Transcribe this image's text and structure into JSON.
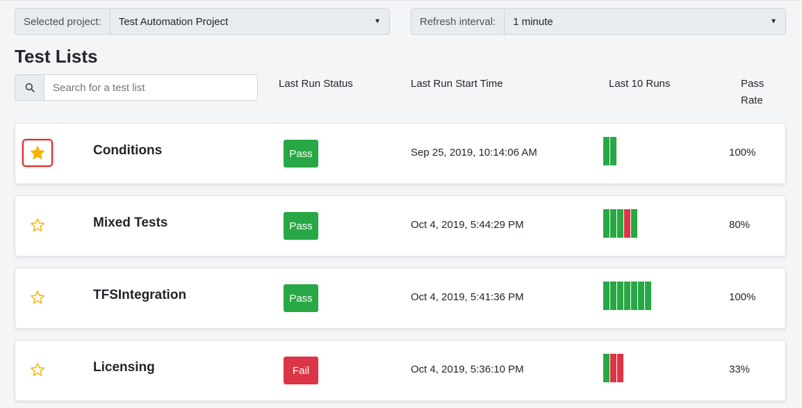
{
  "header": {
    "project_label": "Selected project:",
    "project_value": "Test Automation Project",
    "refresh_label": "Refresh interval:",
    "refresh_value": "1 minute"
  },
  "page_title": "Test Lists",
  "search": {
    "placeholder": "Search for a test list",
    "value": ""
  },
  "columns": {
    "status": "Last Run Status",
    "start_time": "Last Run Start Time",
    "last_runs": "Last 10 Runs",
    "pass_rate": "Pass Rate"
  },
  "colors": {
    "pass": "#28a745",
    "fail": "#dc3545",
    "star": "#f5b301",
    "highlight": "#e02424"
  },
  "test_lists": [
    {
      "name": "Conditions",
      "favorite": true,
      "status": "Pass",
      "start_time": "Sep 25, 2019, 10:14:06 AM",
      "runs": [
        "pass",
        "pass"
      ],
      "pass_rate": "100%"
    },
    {
      "name": "Mixed Tests",
      "favorite": false,
      "status": "Pass",
      "start_time": "Oct 4, 2019, 5:44:29 PM",
      "runs": [
        "pass",
        "pass",
        "pass",
        "fail",
        "pass"
      ],
      "pass_rate": "80%"
    },
    {
      "name": "TFSIntegration",
      "favorite": false,
      "status": "Pass",
      "start_time": "Oct 4, 2019, 5:41:36 PM",
      "runs": [
        "pass",
        "pass",
        "pass",
        "pass",
        "pass",
        "pass",
        "pass"
      ],
      "pass_rate": "100%"
    },
    {
      "name": "Licensing",
      "favorite": false,
      "status": "Fail",
      "start_time": "Oct 4, 2019, 5:36:10 PM",
      "runs": [
        "pass",
        "fail",
        "fail"
      ],
      "pass_rate": "33%"
    }
  ]
}
